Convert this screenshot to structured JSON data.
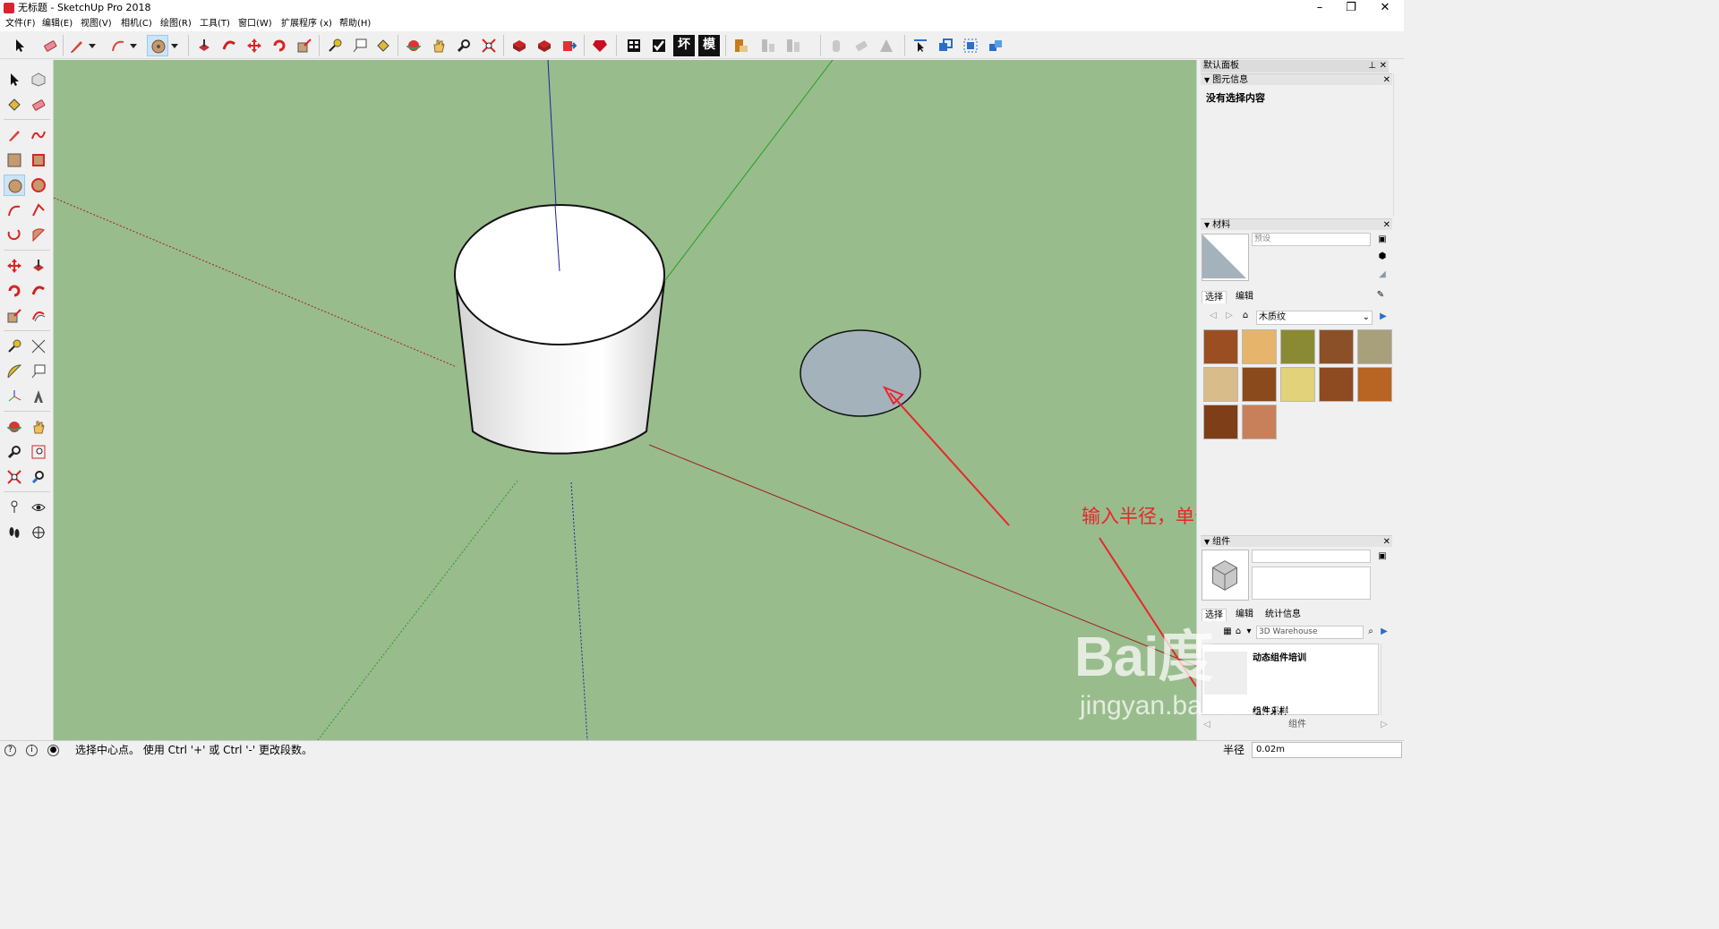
{
  "window": {
    "title": "无标题 - SketchUp Pro 2018",
    "controls": {
      "minimize": "–",
      "maximize": "❐",
      "close": "✕"
    }
  },
  "menu": [
    "文件(F)",
    "编辑(E)",
    "视图(V)",
    "相机(C)",
    "绘图(R)",
    "工具(T)",
    "窗口(W)",
    "扩展程序 (x)",
    "帮助(H)"
  ],
  "toolbar": {
    "buttons": [
      "select-tool-icon",
      "eraser-icon",
      "pencil-icon",
      "arc-icon",
      "circle-icon",
      "push-pull-icon",
      "follow-me-icon",
      "move-icon",
      "rotate-icon",
      "scale-icon",
      "tape-measure-icon",
      "text-icon",
      "paint-bucket-icon",
      "orbit-icon",
      "pan-icon",
      "zoom-icon",
      "zoom-extents-icon",
      "3d-warehouse-icon",
      "extension-warehouse-icon",
      "layout-icon",
      "ruby-icon",
      "model-info-icon",
      "checkmark-icon",
      "section-icon",
      "model-icon"
    ],
    "text_buttons": {
      "section": "坏",
      "model": "模"
    },
    "active": "circle-icon"
  },
  "tray": {
    "title": "默认面板",
    "entity_info": {
      "title": "图元信息",
      "content": "没有选择内容"
    },
    "materials": {
      "title": "材料",
      "preset_label": "预设",
      "tabs": [
        "选择",
        "编辑"
      ],
      "category": "木质纹",
      "swatch_colors": [
        "#9a4e22",
        "#e6b46a",
        "#8a8a34",
        "#8c5028",
        "#a8a07a",
        "#d8bc8a",
        "#8a4a1c",
        "#e2d27a",
        "#8e4a20",
        "#b86422",
        "#7e3e18",
        "#c8805a"
      ]
    },
    "components": {
      "title": "组件",
      "tabs": [
        "选择",
        "编辑",
        "统计信息"
      ],
      "search_placeholder": "3D Warehouse",
      "items": [
        "动态组件培训",
        "组件采样"
      ],
      "footer": "组件"
    }
  },
  "viewport": {
    "background_color": "#99bc8c",
    "annotation": "输入半径，单击确定",
    "annotation_color": "#e8262c"
  },
  "status": {
    "message": "选择中心点。 使用 Ctrl '+' 或 Ctrl '-' 更改段数。",
    "measure_label": "半径",
    "measure_value": "0.02m"
  },
  "watermark": {
    "brand": "Bai度",
    "site": "jingyan.baidu.com"
  }
}
